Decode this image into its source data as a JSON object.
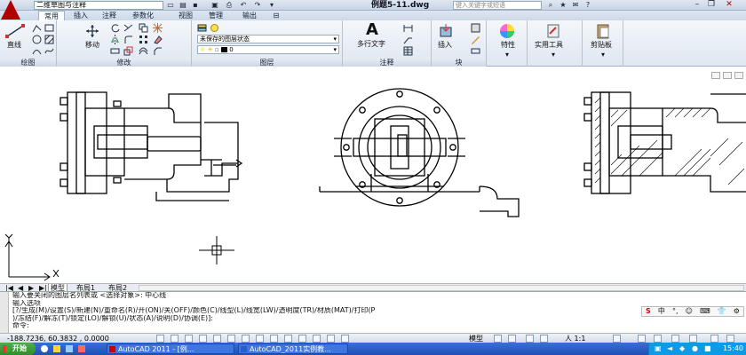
{
  "titlebar": {
    "workspace": "二维草图与注释",
    "document_title": "例题5-11.dwg",
    "help_search_placeholder": "键入关键字或短语"
  },
  "ribbon_tabs": [
    "常用",
    "插入",
    "注释",
    "参数化",
    "视图",
    "管理",
    "输出"
  ],
  "panels": {
    "draw": {
      "title": "绘图",
      "line_label": "直线"
    },
    "modify": {
      "title": "修改",
      "move_label": "移动"
    },
    "layers": {
      "title": "图层",
      "state": "未保存的图层状态",
      "current_layer": "0"
    },
    "annotation": {
      "title": "注释",
      "mtext_label": "多行文字"
    },
    "block": {
      "title": "块",
      "insert_label": "插入"
    },
    "properties": {
      "label": "特性"
    },
    "utilities": {
      "label": "实用工具"
    },
    "clipboard": {
      "label": "剪贴板"
    }
  },
  "layout_tabs": [
    "模型",
    "布局1",
    "布局2"
  ],
  "command": {
    "lines": [
      "输入要关闭的图层名列表或 <选择对象>: 中心线",
      "输入选项",
      "[?/生成(M)/设置(S)/新建(N)/重命名(R)/开(ON)/关(OFF)/颜色(C)/线型(L)/线宽(LW)/透明度(TR)/材质(MAT)/打印(P",
      ")/冻结(F)/解冻(T)/锁定(LO)/解锁(U)/状态(A)/说明(D)/协调(E)]:",
      "命令:"
    ]
  },
  "status": {
    "coordinates": "-188.7236, 60.3832 , 0.0000",
    "model_label": "模型",
    "annotation_scale": "人 1:1"
  },
  "taskbar": {
    "start_label": "开始",
    "items": [
      "AutoCAD 2011 - [例...",
      "AutoCAD_2011实例教..."
    ],
    "clock": "15:40"
  }
}
